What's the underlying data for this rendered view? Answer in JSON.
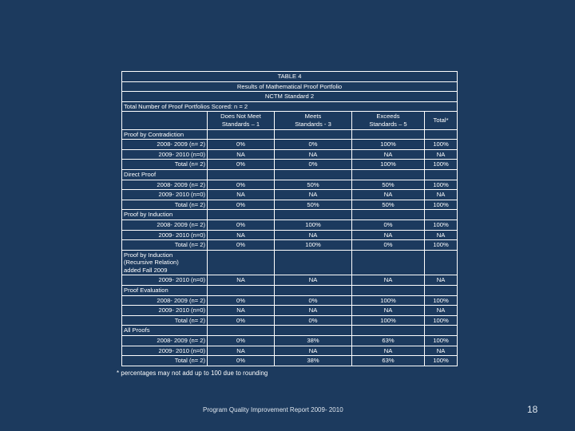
{
  "slide": {
    "background_color": "#1c3a5e",
    "text_color": "#ffffff"
  },
  "table": {
    "title_lines": [
      "TABLE 4",
      "Results of  Mathematical Proof Portfolio",
      "NCTM Standard  2"
    ],
    "total_scored_line": "Total Number of  Proof Portfolios Scored: n =  2",
    "column_headers": [
      "",
      "Does Not Meet\nStandards – 1",
      "Meets\nStandards - 3",
      "Exceeds\nStandards – 5",
      "Total*"
    ],
    "column_headers_flat": {
      "label": "",
      "does_not_meet": "Does Not Meet Standards – 1",
      "does_not_meet_l1": "Does Not Meet",
      "does_not_meet_l2": "Standards – 1",
      "meets": "Meets Standards - 3",
      "meets_l1": "Meets",
      "meets_l2": "Standards - 3",
      "exceeds": "Exceeds Standards – 5",
      "exceeds_l1": "Exceeds",
      "exceeds_l2": "Standards – 5",
      "total": "Total*"
    },
    "sections": [
      {
        "heading": "Proof by Contradiction",
        "rows": [
          {
            "label": "2008- 2009  (n= 2)",
            "does_not_meet": "0%",
            "meets": "0%",
            "exceeds": "100%",
            "total": "100%"
          },
          {
            "label": "2009- 2010 (n=0)",
            "does_not_meet": "NA",
            "meets": "NA",
            "exceeds": "NA",
            "total": "NA"
          },
          {
            "label": "Total (n= 2)",
            "does_not_meet": "0%",
            "meets": "0%",
            "exceeds": "100%",
            "total": "100%"
          }
        ]
      },
      {
        "heading": "Direct Proof",
        "rows": [
          {
            "label": "2008- 2009  (n= 2)",
            "does_not_meet": "0%",
            "meets": "50%",
            "exceeds": "50%",
            "total": "100%"
          },
          {
            "label": "2009- 2010 (n=0)",
            "does_not_meet": "NA",
            "meets": "NA",
            "exceeds": "NA",
            "total": "NA"
          },
          {
            "label": "Total (n= 2)",
            "does_not_meet": "0%",
            "meets": "50%",
            "exceeds": "50%",
            "total": "100%"
          }
        ]
      },
      {
        "heading": "Proof by Induction",
        "rows": [
          {
            "label": "2008- 2009  (n= 2)",
            "does_not_meet": "0%",
            "meets": "100%",
            "exceeds": "0%",
            "total": "100%"
          },
          {
            "label": "2009- 2010 (n=0)",
            "does_not_meet": "NA",
            "meets": "NA",
            "exceeds": "NA",
            "total": "NA"
          },
          {
            "label": "Total (n= 2)",
            "does_not_meet": "0%",
            "meets": "100%",
            "exceeds": "0%",
            "total": "100%"
          }
        ]
      },
      {
        "heading": "Proof by Induction\n(Recursive Relation)\nadded  Fall 2009",
        "heading_l1": "Proof by Induction",
        "heading_l2": "(Recursive Relation)",
        "heading_l3": "added  Fall 2009",
        "rows": [
          {
            "label": "2009- 2010 (n=0)",
            "does_not_meet": "NA",
            "meets": "NA",
            "exceeds": "NA",
            "total": "NA"
          }
        ]
      },
      {
        "heading": "Proof Evaluation",
        "rows": [
          {
            "label": "2008- 2009  (n= 2)",
            "does_not_meet": "0%",
            "meets": "0%",
            "exceeds": "100%",
            "total": "100%"
          },
          {
            "label": "2009- 2010 (n=0)",
            "does_not_meet": "NA",
            "meets": "NA",
            "exceeds": "NA",
            "total": "NA"
          },
          {
            "label": "Total (n= 2)",
            "does_not_meet": "0%",
            "meets": "0%",
            "exceeds": "100%",
            "total": "100%"
          }
        ]
      },
      {
        "heading": "All Proofs",
        "rows": [
          {
            "label": "2008- 2009  (n= 2)",
            "does_not_meet": "0%",
            "meets": "38%",
            "exceeds": "63%",
            "total": "100%"
          },
          {
            "label": "2009- 2010 (n=0)",
            "does_not_meet": "NA",
            "meets": "NA",
            "exceeds": "NA",
            "total": "NA"
          },
          {
            "label": "Total (n= 2)",
            "does_not_meet": "0%",
            "meets": "38%",
            "exceeds": "63%",
            "total": "100%"
          }
        ]
      }
    ]
  },
  "footnote": "* percentages may not add up to 100 due to rounding",
  "footer": {
    "report_title": "Program Quality Improvement Report 2009- 2010",
    "page_number": "18"
  }
}
